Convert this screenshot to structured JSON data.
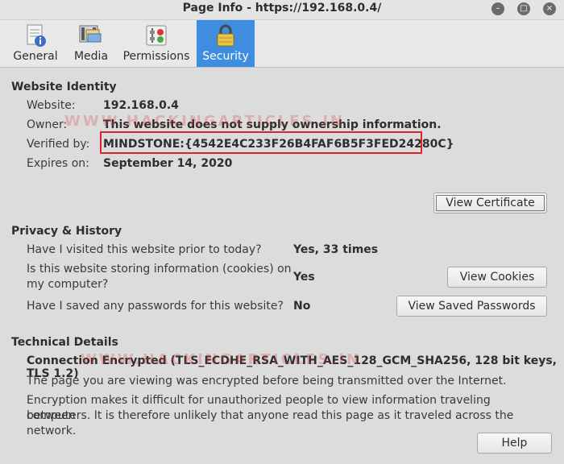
{
  "window": {
    "title": "Page Info - https://192.168.0.4/"
  },
  "tabs": [
    {
      "label": "General",
      "icon": "document-info-icon",
      "active": false
    },
    {
      "label": "Media",
      "icon": "media-icon",
      "active": false
    },
    {
      "label": "Permissions",
      "icon": "permissions-icon",
      "active": false
    },
    {
      "label": "Security",
      "icon": "lock-icon",
      "active": true
    }
  ],
  "identity": {
    "heading": "Website Identity",
    "website_label": "Website:",
    "website_value": "192.168.0.4",
    "owner_label": "Owner:",
    "owner_value": "This website does not supply ownership information.",
    "verified_label": "Verified by:",
    "verified_value": "MINDSTONE:{4542E4C233F26B4FAF6B5F3FED24280C}",
    "expires_label": "Expires on:",
    "expires_value": "September 14, 2020",
    "view_certificate": "View Certificate"
  },
  "privacy": {
    "heading": "Privacy & History",
    "q1": "Have I visited this website prior to today?",
    "a1": "Yes, 33 times",
    "q2_line1": "Is this website storing information (cookies) on",
    "q2_line2": "my computer?",
    "a2": "Yes",
    "view_cookies": "View Cookies",
    "q3": "Have I saved any passwords for this website?",
    "a3": "No",
    "view_passwords": "View Saved Passwords"
  },
  "technical": {
    "heading": "Technical Details",
    "connection": "Connection Encrypted (TLS_ECDHE_RSA_WITH_AES_128_GCM_SHA256, 128 bit keys, TLS 1.2)",
    "line1": "The page you are viewing was encrypted before being transmitted over the Internet.",
    "line2a": "Encryption makes it difficult for unauthorized people to view information traveling between",
    "line2b": "computers. It is therefore unlikely that anyone read this page as it traveled across the network."
  },
  "help": "Help",
  "watermark": "WWW.HACKINGARTICLES.IN",
  "colors": {
    "accent": "#3d8ee0",
    "highlight": "#d9262c"
  }
}
